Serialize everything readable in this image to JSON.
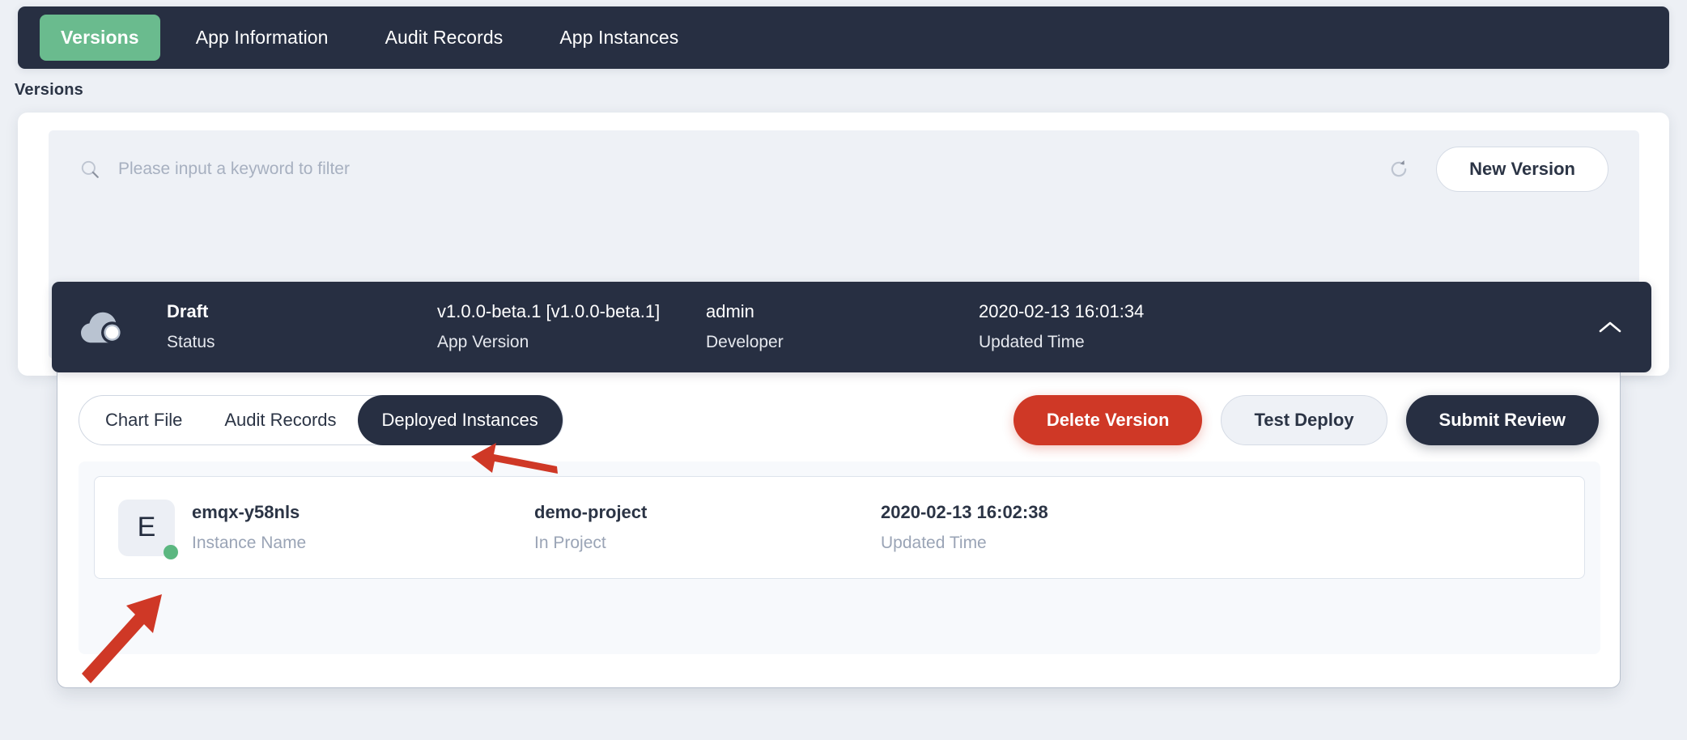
{
  "topbar": {
    "tabs": [
      {
        "label": "Versions",
        "active": true
      },
      {
        "label": "App Information",
        "active": false
      },
      {
        "label": "Audit Records",
        "active": false
      },
      {
        "label": "App Instances",
        "active": false
      }
    ],
    "active_color": "#6abb8e",
    "bar_color": "#272f42"
  },
  "page": {
    "title": "Versions",
    "background_color": "#edf0f5"
  },
  "search": {
    "icon": "search-icon",
    "value": "",
    "placeholder": "Please input a keyword to filter",
    "refresh_icon": "refresh-icon",
    "new_version_label": "New Version"
  },
  "version_header": {
    "icon": "cloud-status-icon",
    "collapse_icon": "chevron-up-icon",
    "columns": [
      {
        "value": "Draft",
        "label": "Status",
        "bold": true
      },
      {
        "value": "v1.0.0-beta.1 [v1.0.0-beta.1]",
        "label": "App Version",
        "bold": false
      },
      {
        "value": "admin",
        "label": "Developer",
        "bold": false
      },
      {
        "value": "2020-02-13 16:01:34",
        "label": "Updated Time",
        "bold": false
      }
    ]
  },
  "detail": {
    "segments": [
      {
        "label": "Chart File",
        "active": false
      },
      {
        "label": "Audit Records",
        "active": false
      },
      {
        "label": "Deployed Instances",
        "active": true
      }
    ],
    "actions": [
      {
        "label": "Delete Version",
        "style": "danger",
        "color": "#cf3826"
      },
      {
        "label": "Test Deploy",
        "style": "ghost",
        "color": "#eef1f6"
      },
      {
        "label": "Submit Review",
        "style": "dark",
        "color": "#272f42"
      }
    ],
    "instances": [
      {
        "avatar_letter": "E",
        "status_color": "#5bb780",
        "name": "emqx-y58nls",
        "name_label": "Instance Name",
        "project": "demo-project",
        "project_label": "In Project",
        "updated": "2020-02-13 16:02:38",
        "updated_label": "Updated Time"
      }
    ]
  },
  "annotations": {
    "arrow_color": "#cf3826",
    "arrows": [
      {
        "name": "arrow-to-deployed-instances-tab",
        "direction": "left"
      },
      {
        "name": "arrow-to-instance-status-dot",
        "direction": "up-right"
      }
    ]
  }
}
